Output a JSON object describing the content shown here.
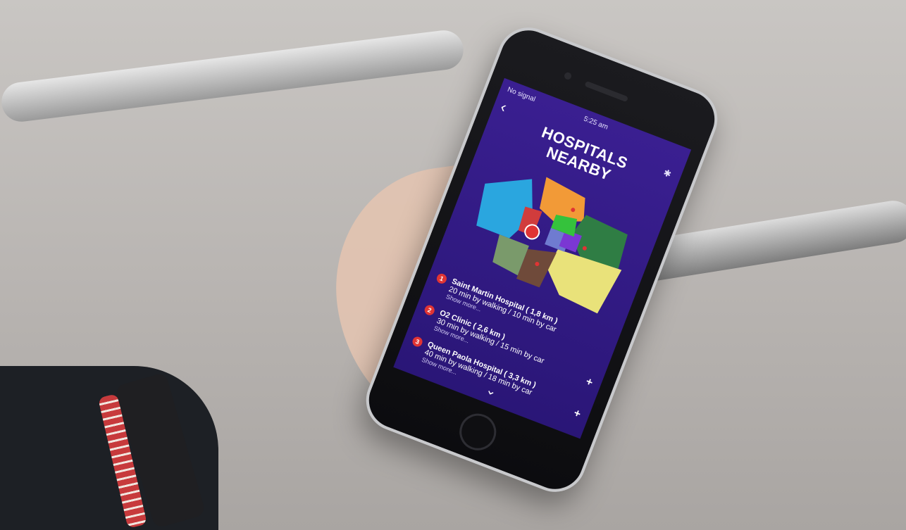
{
  "screen": {
    "status": {
      "signal": "No signal",
      "time": "5:25 am"
    },
    "title_line1": "HOSPITALS",
    "title_line2": "NEARBY",
    "hospitals": [
      {
        "number": "1",
        "name": "Saint Martin Hospital ( 1,8 km )",
        "distance": "20 min by walking / 10 min by car",
        "show_more": "Show more..."
      },
      {
        "number": "2",
        "name": "O2 Clinic ( 2,6 km )",
        "distance": "30 min by walking / 15 min by car",
        "show_more": "Show more..."
      },
      {
        "number": "3",
        "name": "Queen Paola Hospital ( 3,3 km )",
        "distance": "40 min by walking / 18 min by car",
        "show_more": "Show more..."
      }
    ]
  },
  "colors": {
    "screen_bg": "#2a1677",
    "marker_red": "#e03434",
    "map_regions": [
      "#2aa6df",
      "#f29a37",
      "#2f7d44",
      "#e9e27a",
      "#6f4a3a",
      "#7a9a6b",
      "#6f7bd0",
      "#7b37d3",
      "#35c23c",
      "#d13c3c"
    ]
  },
  "icons": {
    "back": "chevron-left-icon",
    "bluetooth": "bluetooth-icon",
    "expand": "plus-icon",
    "scroll_down": "chevron-down-icon"
  }
}
